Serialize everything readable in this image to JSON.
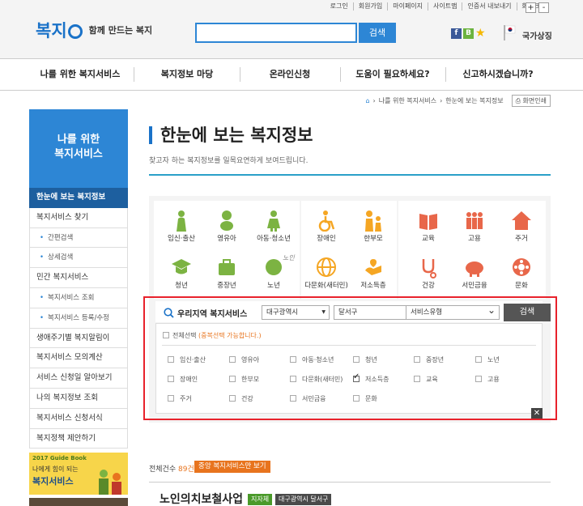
{
  "util_links": [
    "로그인",
    "회원가입",
    "마이페이지",
    "사이트맵",
    "인증서 내보내기",
    "화면크기"
  ],
  "zoom": {
    "plus": "+",
    "minus": "-"
  },
  "logo": {
    "mark": "복지",
    "slogan": "함께 만드는 복지"
  },
  "search": {
    "placeholder": "",
    "button": "검색"
  },
  "sns": [
    "f",
    "B"
  ],
  "national_symbol": "국가상징",
  "gnb": [
    "나를 위한 복지서비스",
    "복지정보 마당",
    "온라인신청",
    "도움이 필요하세요?",
    "신고하시겠습니까?"
  ],
  "breadcrumb": [
    "나를 위한 복지서비스",
    "한눈에 보는 복지정보"
  ],
  "print_label": "화면인쇄",
  "lnb_head": [
    "나를 위한",
    "복지서비스"
  ],
  "lnb": [
    {
      "label": "한눈에 보는 복지정보",
      "type": "active"
    },
    {
      "label": "복지서비스 찾기",
      "type": "main"
    },
    {
      "label": "간편검색",
      "type": "sub"
    },
    {
      "label": "상세검색",
      "type": "sub"
    },
    {
      "label": "민간 복지서비스",
      "type": "main"
    },
    {
      "label": "복지서비스 조회",
      "type": "sub"
    },
    {
      "label": "복지서비스 등록/수정",
      "type": "sub"
    },
    {
      "label": "생애주기별 복지알림이",
      "type": "main"
    },
    {
      "label": "복지서비스 모의계산",
      "type": "main"
    },
    {
      "label": "서비스 신청일 알아보기",
      "type": "main"
    },
    {
      "label": "나의 복지정보 조회",
      "type": "main"
    },
    {
      "label": "복지서비스 신청서식",
      "type": "main"
    },
    {
      "label": "복지정책 제안하기",
      "type": "main"
    }
  ],
  "banner": {
    "year": "2017 Guide Book",
    "line1": "나에게 힘이 되는",
    "line2": "복지서비스"
  },
  "page_title": "한눈에 보는 복지정보",
  "page_desc": "찾고자 하는 복지정보를 일목요연하게 보여드립니다.",
  "services": [
    "임신·출산",
    "영유아",
    "아동·청소년",
    "청년",
    "중장년",
    "노년",
    "장애인",
    "한부모",
    "다문화(새터민)",
    "저소득층",
    "교육",
    "고용",
    "주거",
    "건강",
    "서민금융",
    "문화"
  ],
  "sticker": "노인",
  "filter": {
    "label": "우리지역 복지서비스",
    "region1": "대구광역시",
    "region2": "달서구",
    "type": "서비스유형",
    "button": "검색"
  },
  "checkall": {
    "label": "전체선택",
    "note": "(중복선택 가능합니다.)"
  },
  "checks": [
    {
      "label": "임신·출산",
      "checked": false
    },
    {
      "label": "영유아",
      "checked": false
    },
    {
      "label": "아동·청소년",
      "checked": false
    },
    {
      "label": "청년",
      "checked": false
    },
    {
      "label": "중장년",
      "checked": false
    },
    {
      "label": "노년",
      "checked": false
    },
    {
      "label": "장애인",
      "checked": false
    },
    {
      "label": "한부모",
      "checked": false
    },
    {
      "label": "다문화(새터민)",
      "checked": false
    },
    {
      "label": "저소득층",
      "checked": true
    },
    {
      "label": "교육",
      "checked": false
    },
    {
      "label": "고용",
      "checked": false
    },
    {
      "label": "주거",
      "checked": false
    },
    {
      "label": "건강",
      "checked": false
    },
    {
      "label": "서민금융",
      "checked": false
    },
    {
      "label": "문화",
      "checked": false
    }
  ],
  "close": "✕",
  "result": {
    "prefix": "전체건수",
    "count": "89건",
    "button": "중앙 복지서비스만 보기"
  },
  "item": {
    "title": "노인의치보철사업",
    "tag1": "지자체",
    "tag2": "대구광역시 달서구"
  },
  "colors": {
    "primary": "#2d86d5",
    "green": "#7cb342",
    "orange": "#e8741e",
    "red": "#e8222c"
  }
}
